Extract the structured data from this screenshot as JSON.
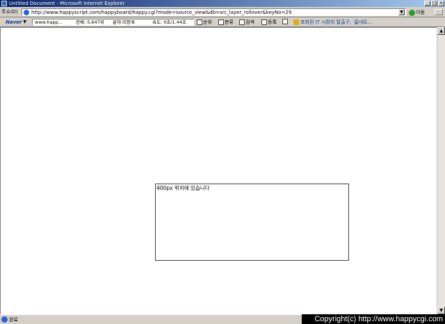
{
  "window": {
    "title": "Untitled Document - Microsoft Internet Explorer",
    "controls": {
      "minimize": "_",
      "maximize": "□",
      "close": "×"
    }
  },
  "addressbar": {
    "label": "주소(D)",
    "url": "http://www.happyscript.com/happyboard/happy.cgi?mode=source_view&db=src_layer_rollover&keyNo=29",
    "go_label": "이동"
  },
  "toolbar": {
    "naver_label": "Naver",
    "site_text": "www.happ...",
    "total_text": "전체: 5,647위",
    "category_text": "분야:미등록",
    "speed_text": "속도: 0초/1.44초",
    "rank_label": "순위",
    "classify_label": "분류",
    "search_label": "검색",
    "register_label": "등록",
    "news_text": "포화된 IT 시장의 탈출구, '홈네트..."
  },
  "content": {
    "box_text": "400px 위치에 있습니다"
  },
  "status": {
    "text": "완료"
  },
  "overlay": {
    "copyright": "Copyright(c) http://www.happycgi.com"
  },
  "icons": [
    "ie-page-icon",
    "go-arrow-icon",
    "scroll-up-icon",
    "scroll-down-icon",
    "mail-icon"
  ]
}
